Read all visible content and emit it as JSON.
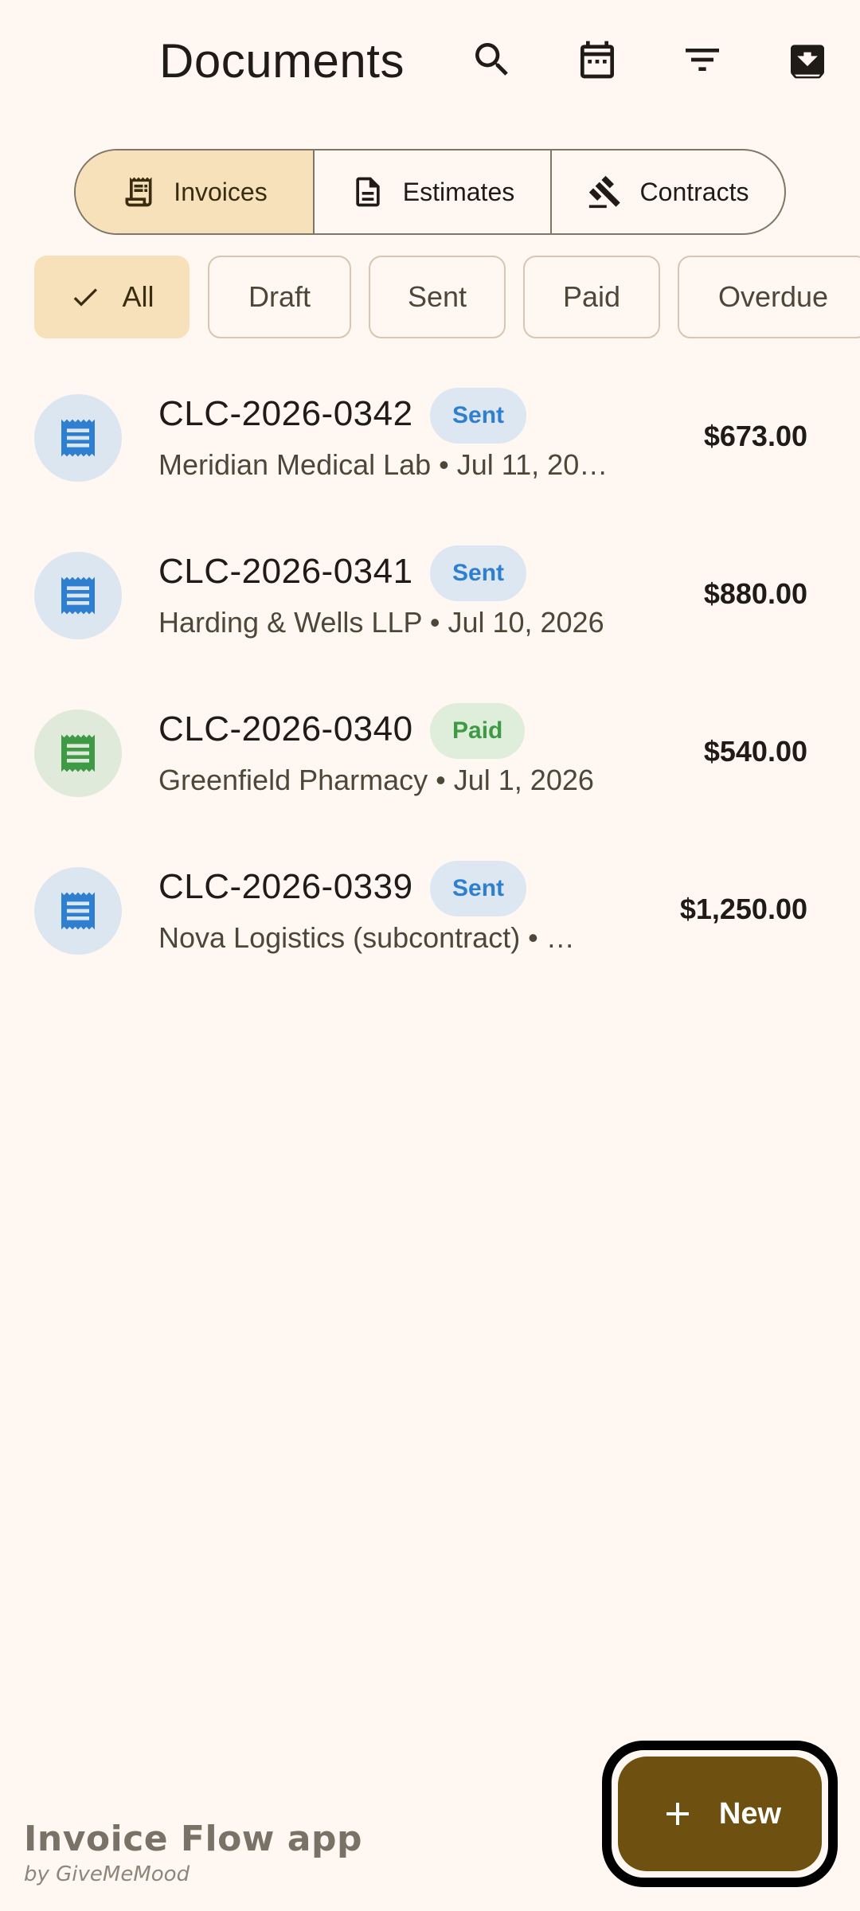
{
  "header": {
    "title": "Documents",
    "icons": [
      "search-icon",
      "calendar-icon",
      "filter-icon",
      "archive-icon"
    ]
  },
  "segments": [
    {
      "label": "Invoices",
      "icon": "invoice-icon",
      "selected": true
    },
    {
      "label": "Estimates",
      "icon": "document-icon",
      "selected": false
    },
    {
      "label": "Contracts",
      "icon": "gavel-icon",
      "selected": false
    }
  ],
  "filters": [
    {
      "label": "All",
      "selected": true
    },
    {
      "label": "Draft",
      "selected": false
    },
    {
      "label": "Sent",
      "selected": false
    },
    {
      "label": "Paid",
      "selected": false
    },
    {
      "label": "Overdue",
      "selected": false
    }
  ],
  "invoices": [
    {
      "number": "CLC-2026-0342",
      "status": "Sent",
      "subtitle": "Meridian Medical Lab • Jul 11, 20…",
      "amount": "$673.00"
    },
    {
      "number": "CLC-2026-0341",
      "status": "Sent",
      "subtitle": "Harding & Wells LLP • Jul 10, 2026",
      "amount": "$880.00"
    },
    {
      "number": "CLC-2026-0340",
      "status": "Paid",
      "subtitle": "Greenfield Pharmacy • Jul 1, 2026",
      "amount": "$540.00"
    },
    {
      "number": "CLC-2026-0339",
      "status": "Sent",
      "subtitle": "Nova Logistics (subcontract) • …",
      "amount": "$1,250.00"
    }
  ],
  "fab": {
    "label": "New"
  },
  "brand": {
    "name": "Invoice Flow app",
    "by": "by GiveMeMood"
  },
  "colors": {
    "background": "#fff7f2",
    "selected_fill": "#f6e1bb",
    "sent_blue": "#2f7fd0",
    "paid_green": "#3f9a45",
    "fab": "#6e5110"
  }
}
